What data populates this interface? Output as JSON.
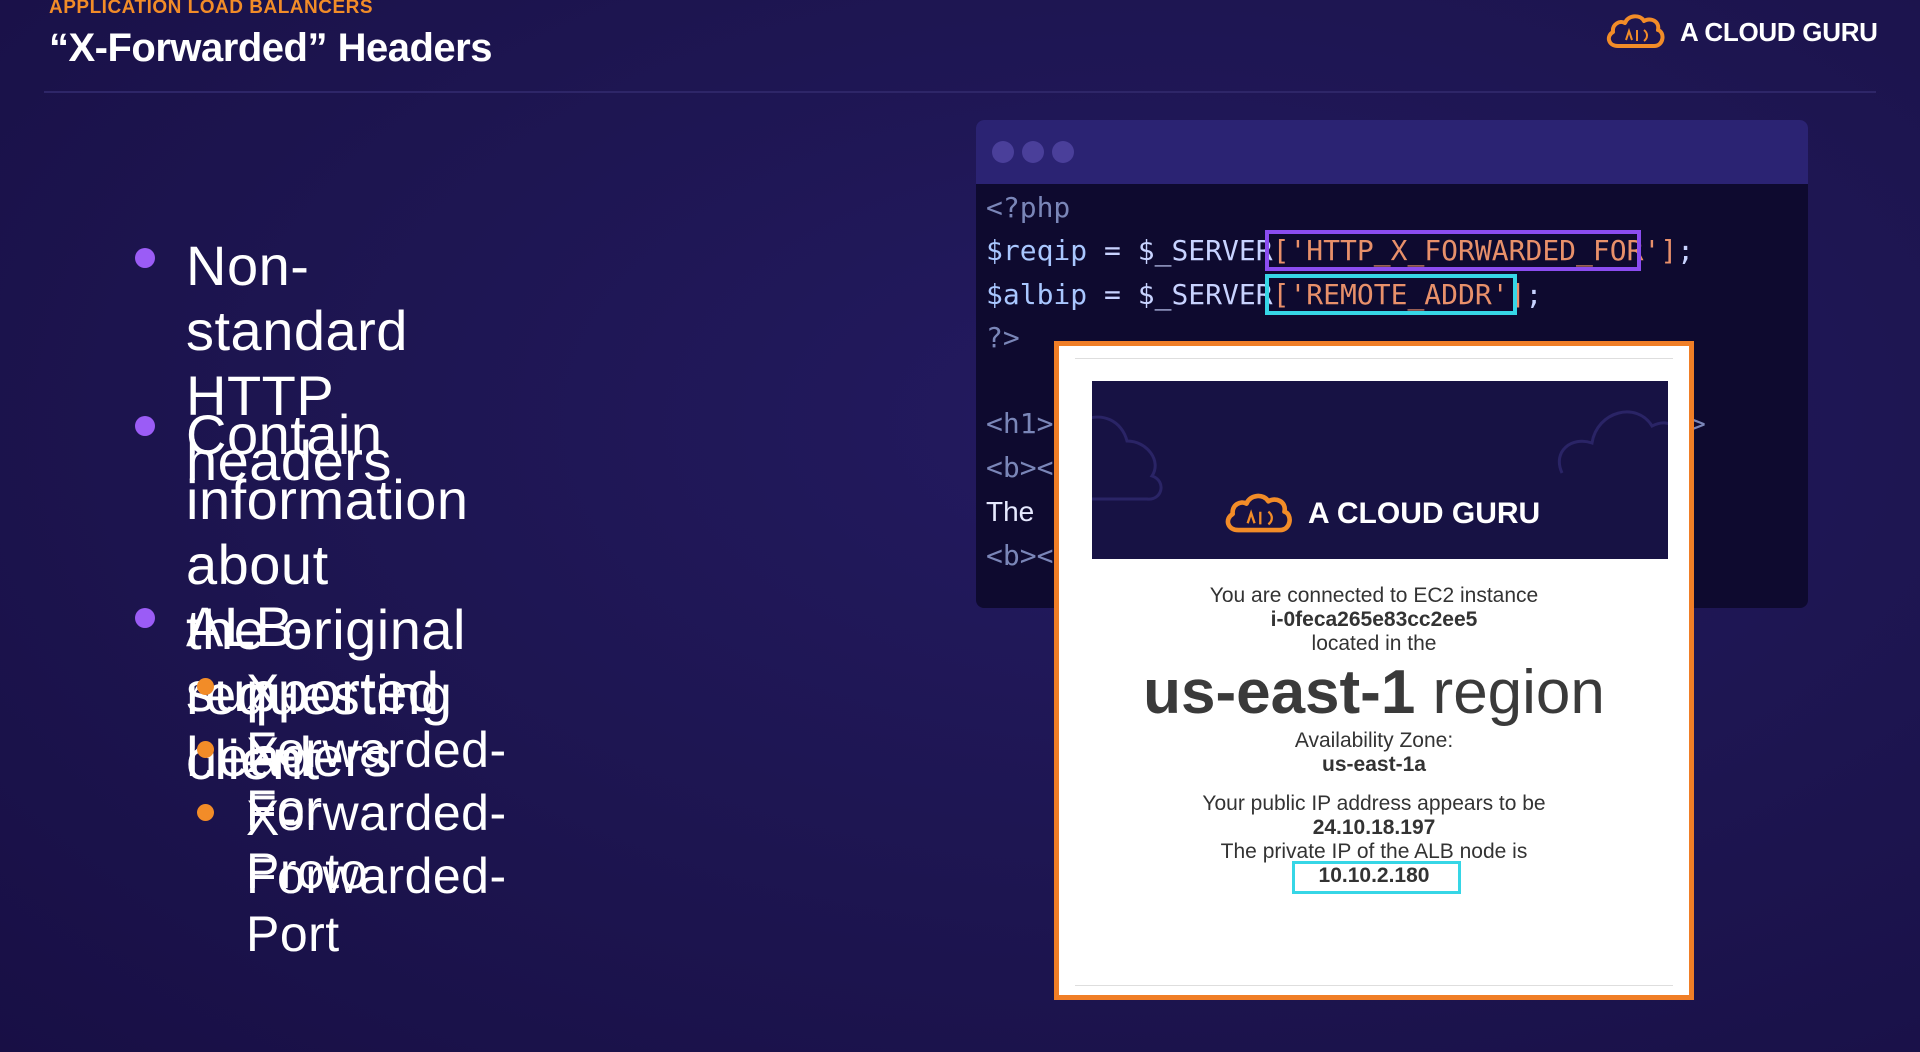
{
  "header": {
    "eyebrow": "APPLICATION LOAD BALANCERS",
    "title": "“X-Forwarded” Headers",
    "brand": "A CLOUD GURU"
  },
  "bullets": [
    {
      "line1": "Non-standard HTTP",
      "line2": "headers"
    },
    {
      "line1": "Contain information about",
      "line2": "the original requesting client"
    },
    {
      "line1": "ALB-supported headers"
    }
  ],
  "sub_bullets": [
    "X-Forwarded-For",
    "X-Forwarded-Proto",
    "X-Forwarded-Port"
  ],
  "code": {
    "line1": "<?php",
    "line2_var": "$reqip",
    "line2_op": " = $_SERVER",
    "line2_key": "['HTTP_X_FORWARDED_FOR']",
    "line2_end": ";",
    "line3_var": "$albip",
    "line3_op": " = $_SERVER",
    "line3_key": "['REMOTE_ADDR']",
    "line3_end": ";",
    "line4": "?>",
    "line5": "<h1>",
    "line5_tail": ">",
    "line6": "<b><",
    "line7": "The",
    "line8": "<b><"
  },
  "page": {
    "brand": "A CLOUD GURU",
    "connected_text": "You are connected to EC2 instance",
    "instance_id": "i-0feca265e83cc2ee5",
    "located_text": "located in the",
    "region_code": "us-east-1",
    "region_word": "region",
    "az_label": "Availability Zone:",
    "az_value": "us-east-1a",
    "public_ip_label": "Your public IP address appears to be",
    "public_ip": "24.10.18.197",
    "private_ip_label": "The private IP of the ALB node is",
    "private_ip": "10.10.2.180"
  },
  "colors": {
    "background": "#1d1550",
    "accent_orange": "#f28c28",
    "accent_purple": "#9b5cf6",
    "highlight_cyan": "#36d6e6"
  }
}
